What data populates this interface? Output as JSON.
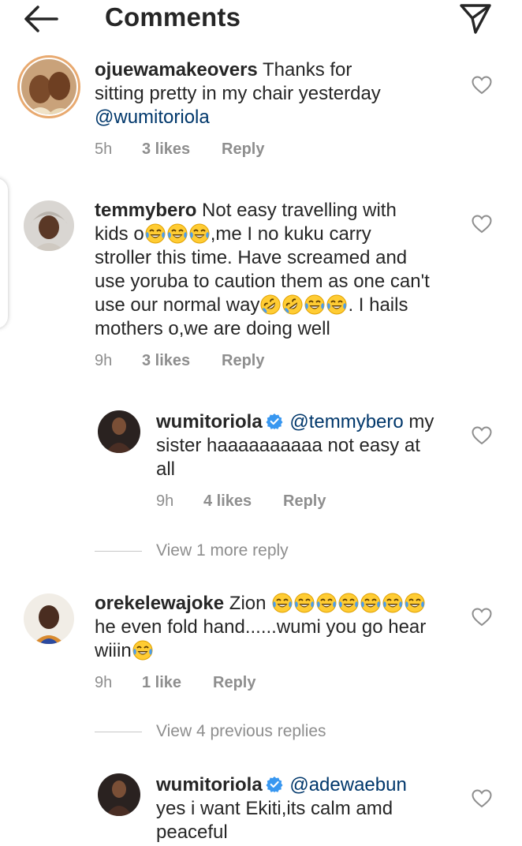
{
  "header": {
    "title": "Comments"
  },
  "comments": [
    {
      "username": "ojuewamakeovers",
      "text_lines": [
        "Thanks for",
        "sitting pretty in my chair yesterday"
      ],
      "mention": "@wumitoriola",
      "time": "5h",
      "likes": "3 likes",
      "reply": "Reply"
    },
    {
      "username": "temmybero",
      "text_line1": "Not easy travelling with",
      "text_line2_a": "kids o",
      "text_line2_b": ",me I no kuku carry",
      "text_line3": "stroller this time. Have screamed and",
      "text_line4": "use yoruba to caution them as one can't",
      "text_line5_a": "use our normal way",
      "text_line5_b": ". I hails",
      "text_line6": "mothers o,we are doing well",
      "time": "9h",
      "likes": "3 likes",
      "reply": "Reply"
    },
    {
      "username": "wumitoriola",
      "mention": "@temmybero",
      "text_line1": "my",
      "text_line2": "sister haaaaaaaaaa not easy at",
      "text_line3": "all",
      "time": "9h",
      "likes": "4 likes",
      "reply": "Reply"
    },
    {
      "username": "orekelewajoke",
      "text_line1": "Zion",
      "text_line2": "he even fold hand......wumi you go hear",
      "text_line3": "wiiin",
      "time": "9h",
      "likes": "1 like",
      "reply": "Reply"
    },
    {
      "username": "wumitoriola",
      "mention": "@adewaebun",
      "text_line2": "yes i want Ekiti,its calm amd",
      "text_line3": "peaceful"
    }
  ],
  "view_more_1": "View 1 more reply",
  "view_more_2": "View 4 previous replies",
  "icons": {
    "back": "arrow-left-icon",
    "share": "paper-plane-icon",
    "like": "heart-outline-icon",
    "verified": "verified-badge-icon",
    "emoji_laugh": "face-with-tears-of-joy",
    "emoji_rofl": "rolling-on-floor-laughing"
  },
  "colors": {
    "text": "#262626",
    "muted": "#8e8e8e",
    "mention": "#00376b",
    "verified": "#3897f0"
  }
}
